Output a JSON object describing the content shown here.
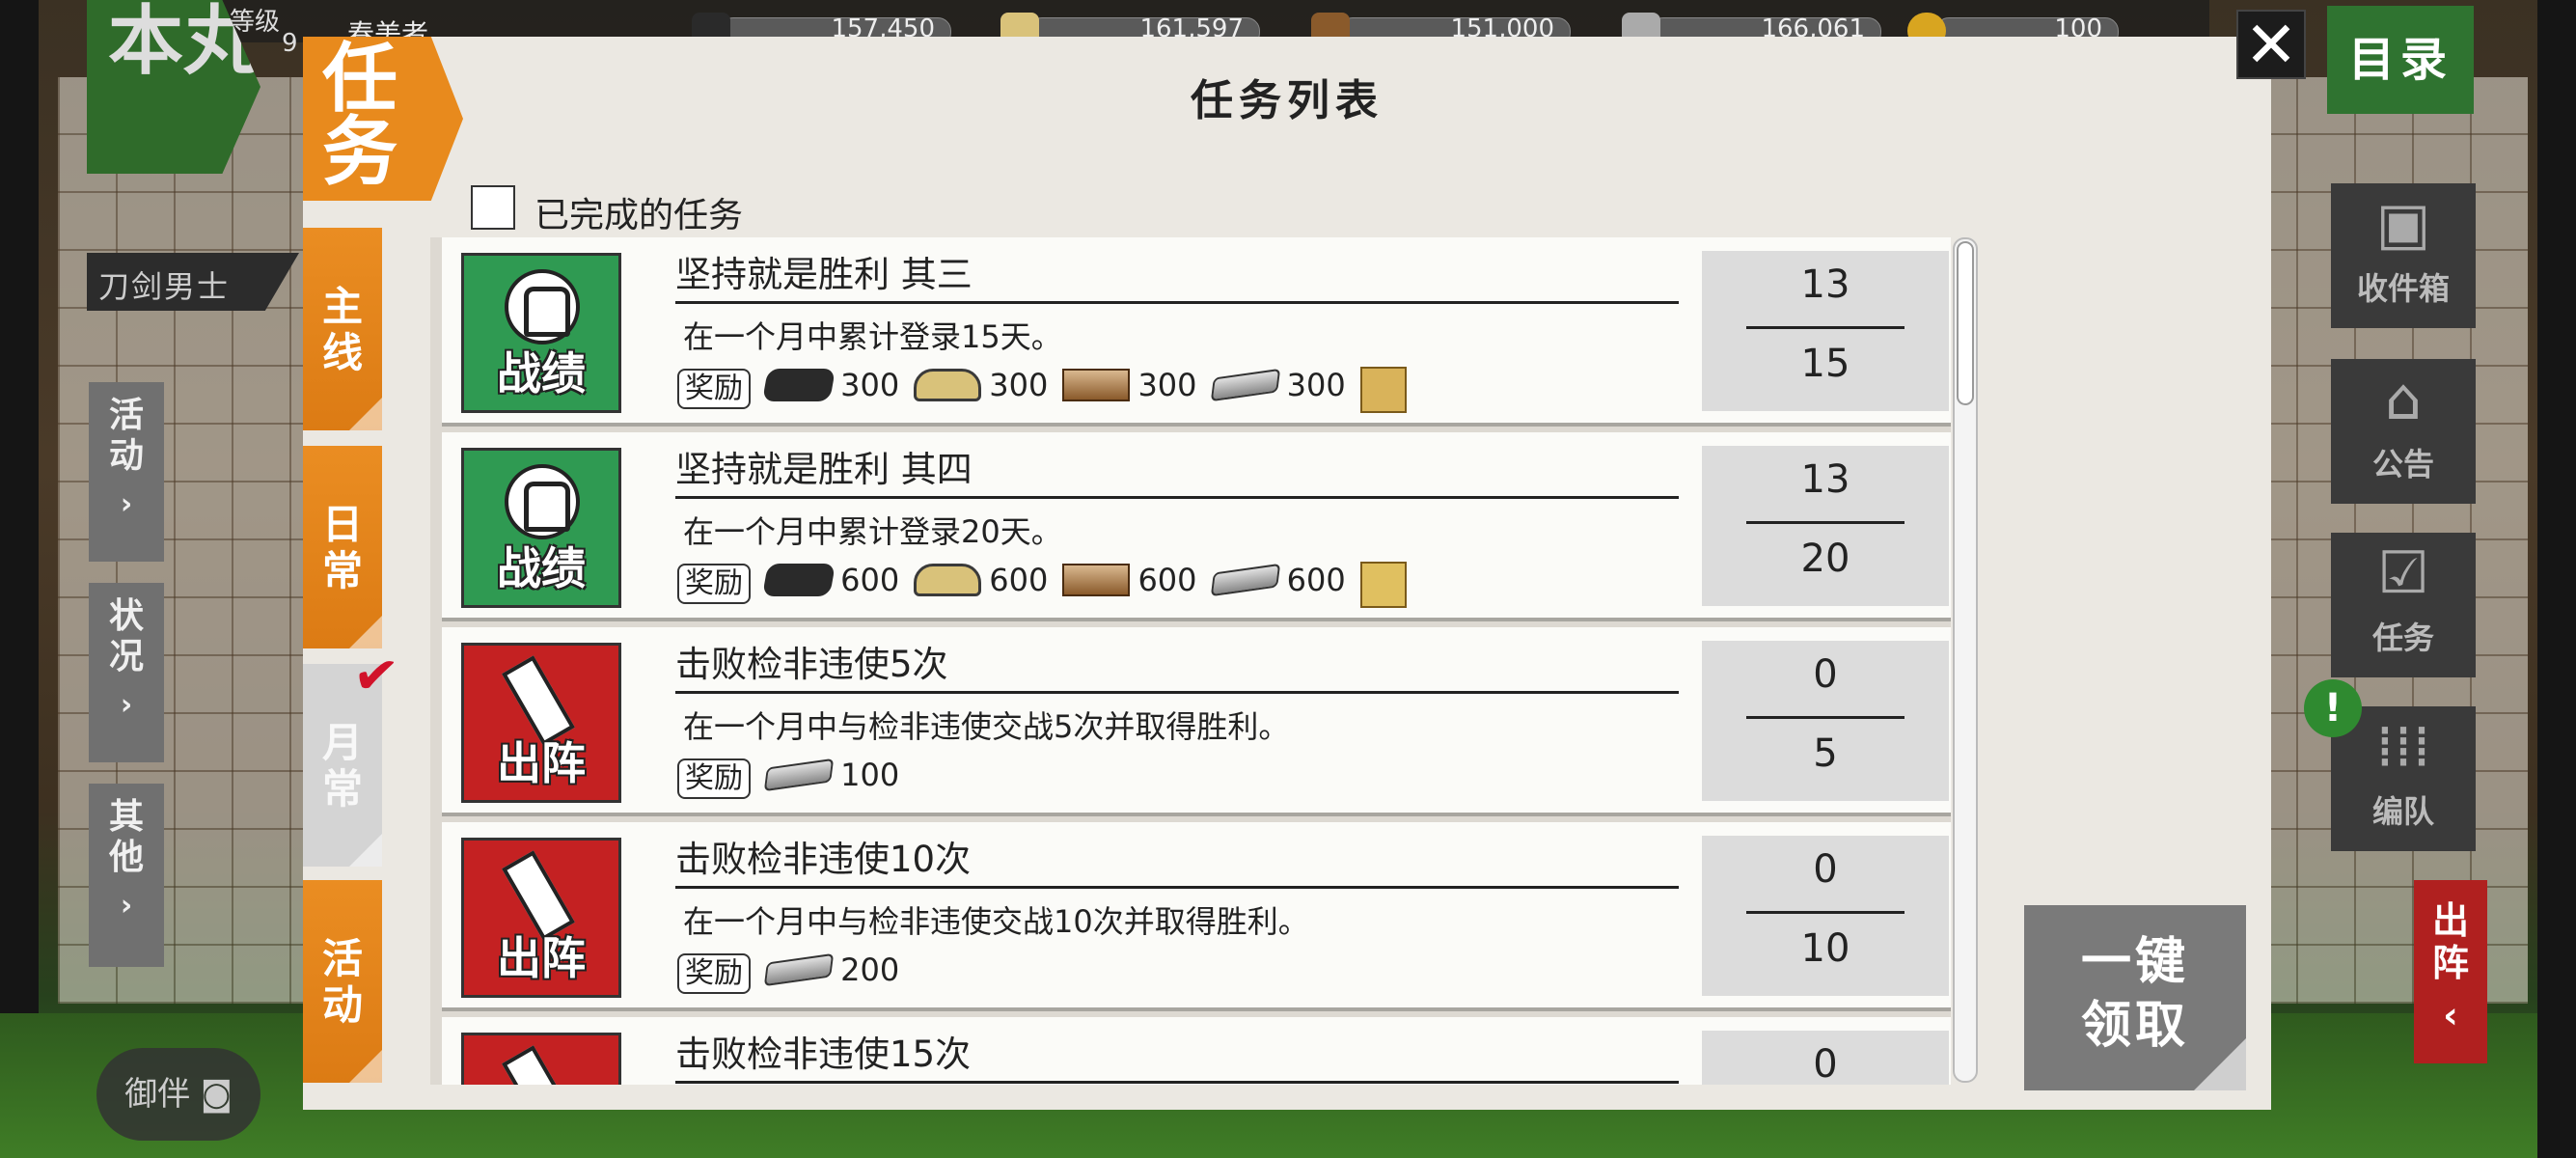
{
  "hud": {
    "level_label": "等级",
    "level_value": "9",
    "player_name": "春美者",
    "resources": [
      {
        "icon": "charcoal-icon",
        "value": "157,450"
      },
      {
        "icon": "coolant-icon",
        "value": "161,597"
      },
      {
        "icon": "whetstone-icon",
        "value": "151,000"
      },
      {
        "icon": "steel-icon",
        "value": "166,061"
      },
      {
        "icon": "coin-icon",
        "value": "100"
      }
    ],
    "honmaru": "本丸",
    "sword_boys": "刀剑男士",
    "left_nav": [
      {
        "label": "活动"
      },
      {
        "label": "状况"
      },
      {
        "label": "其他"
      }
    ],
    "companion": "御伴",
    "mokuroku": "目录",
    "right_nav": [
      {
        "label": "收件箱",
        "icon": "gift-icon"
      },
      {
        "label": "公告",
        "icon": "house-icon"
      },
      {
        "label": "任务",
        "icon": "checklist-icon"
      },
      {
        "label": "编队",
        "icon": "formation-icon"
      }
    ],
    "alert": "!",
    "sortie": "出阵"
  },
  "dialog": {
    "title": "任务列表",
    "corner_tab": "任务",
    "tabs": [
      {
        "label": "主线",
        "active": false
      },
      {
        "label": "日常",
        "active": false
      },
      {
        "label": "月常",
        "active": true
      },
      {
        "label": "活动",
        "active": false
      }
    ],
    "completed_filter": "已完成的任务",
    "reward_tag": "奖励",
    "claim_all": "一键领取",
    "quests": [
      {
        "category": "战绩",
        "type": "record",
        "title": "坚持就是胜利 其三",
        "description": "在一个月中累计登录15天。",
        "rewards": [
          {
            "icon": "charcoal",
            "amount": "300"
          },
          {
            "icon": "coolant",
            "amount": "300"
          },
          {
            "icon": "whetstone",
            "amount": "300"
          },
          {
            "icon": "steel",
            "amount": "300"
          },
          {
            "icon": "bonus-scroll",
            "amount": ""
          }
        ],
        "progress": "13",
        "goal": "15"
      },
      {
        "category": "战绩",
        "type": "record",
        "title": "坚持就是胜利 其四",
        "description": "在一个月中累计登录20天。",
        "rewards": [
          {
            "icon": "charcoal",
            "amount": "600"
          },
          {
            "icon": "coolant",
            "amount": "600"
          },
          {
            "icon": "whetstone",
            "amount": "600"
          },
          {
            "icon": "steel",
            "amount": "600"
          },
          {
            "icon": "gold-token",
            "amount": ""
          }
        ],
        "progress": "13",
        "goal": "20"
      },
      {
        "category": "出阵",
        "type": "sortie",
        "title": "击败检非违使5次",
        "description": "在一个月中与检非违使交战5次并取得胜利。",
        "rewards": [
          {
            "icon": "steel",
            "amount": "100"
          }
        ],
        "progress": "0",
        "goal": "5"
      },
      {
        "category": "出阵",
        "type": "sortie",
        "title": "击败检非违使10次",
        "description": "在一个月中与检非违使交战10次并取得胜利。",
        "rewards": [
          {
            "icon": "steel",
            "amount": "200"
          }
        ],
        "progress": "0",
        "goal": "10"
      },
      {
        "category": "出阵",
        "type": "sortie",
        "title": "击败检非违使15次",
        "description": "",
        "rewards": [],
        "progress": "0",
        "goal": ""
      }
    ]
  },
  "colors": {
    "orange_tab": "#e88a1d",
    "record_green": "#2f9a52",
    "sortie_red": "#c42122",
    "honmaru_green": "#2f6b2a"
  }
}
